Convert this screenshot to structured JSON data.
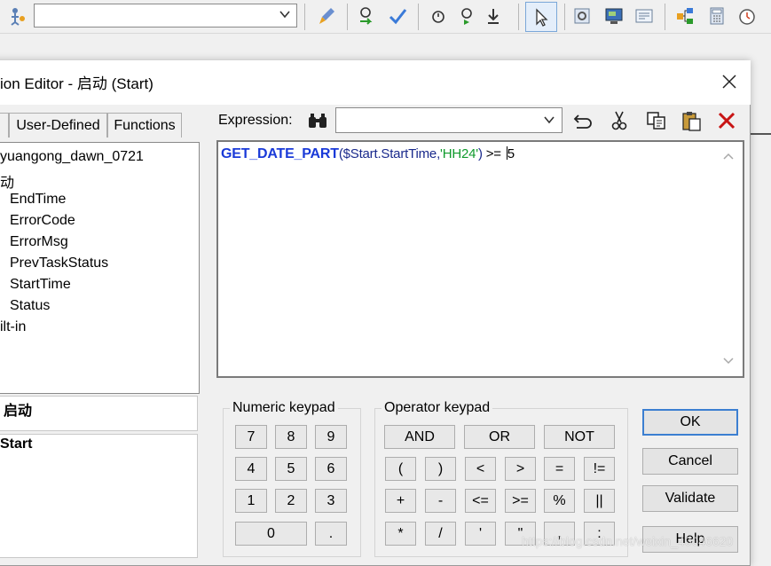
{
  "dialog": {
    "title": "ion Editor - 启动 (Start)"
  },
  "tabs": [
    "User-Defined",
    "Functions"
  ],
  "tree": {
    "items": [
      "yuangong_dawn_0721",
      "动",
      "EndTime",
      "ErrorCode",
      "ErrorMsg",
      "PrevTaskStatus",
      "StartTime",
      "Status",
      "ilt-in"
    ]
  },
  "panels": {
    "upper": "启动",
    "lower": "Start"
  },
  "expression": {
    "label": "Expression:",
    "value": "",
    "code": {
      "fn": "GET_DATE_PART",
      "open": "(",
      "var": "$Start.StartTime",
      "comma": ",",
      "str": "'HH24'",
      "close": ")",
      "op": " >= ",
      "num": "5"
    }
  },
  "numeric_keypad": {
    "label": "Numeric keypad",
    "keys": [
      "7",
      "8",
      "9",
      "4",
      "5",
      "6",
      "1",
      "2",
      "3",
      "0",
      "."
    ]
  },
  "operator_keypad": {
    "label": "Operator keypad",
    "row1": [
      "AND",
      "OR",
      "NOT"
    ],
    "row2": [
      "(",
      ")",
      "<",
      ">",
      "=",
      "!="
    ],
    "row3": [
      "+",
      "-",
      "<=",
      ">=",
      "%",
      "||"
    ],
    "row4": [
      "*",
      "/",
      "'",
      "\"",
      ",",
      ":"
    ]
  },
  "buttons": {
    "ok": "OK",
    "cancel": "Cancel",
    "validate": "Validate",
    "help": "Help"
  },
  "watermark": "https://blog.csdn.net/weixin_40046620",
  "colors": {
    "function": "#1a3ad8",
    "string": "#0f9a2c",
    "variable": "#1a2a8c",
    "focus_border": "#3c7fd1"
  }
}
